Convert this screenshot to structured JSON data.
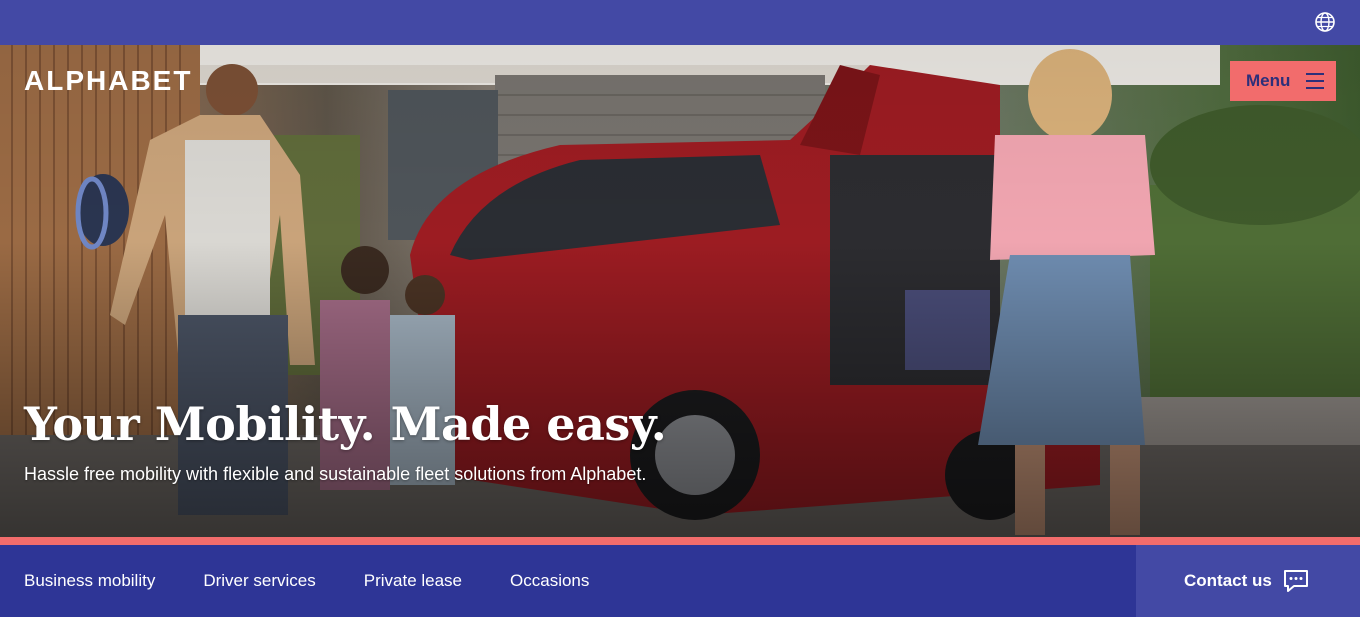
{
  "topbar": {
    "language_icon": "globe-icon"
  },
  "header": {
    "logo": "ALPHABET",
    "menu_label": "Menu",
    "menu_icon": "hamburger-icon"
  },
  "hero": {
    "title": "Your Mobility. Made easy.",
    "subtitle": "Hassle free mobility with flexible and sustainable fleet solutions from Alphabet."
  },
  "nav": {
    "items": [
      {
        "label": "Business mobility"
      },
      {
        "label": "Driver services"
      },
      {
        "label": "Private lease"
      },
      {
        "label": "Occasions"
      }
    ]
  },
  "contact": {
    "label": "Contact us",
    "icon": "chat-bubble-icon"
  },
  "colors": {
    "brand_blue": "#2e3596",
    "topbar_blue": "#4349a5",
    "accent_coral": "#f26c6c",
    "text_white": "#ffffff"
  }
}
